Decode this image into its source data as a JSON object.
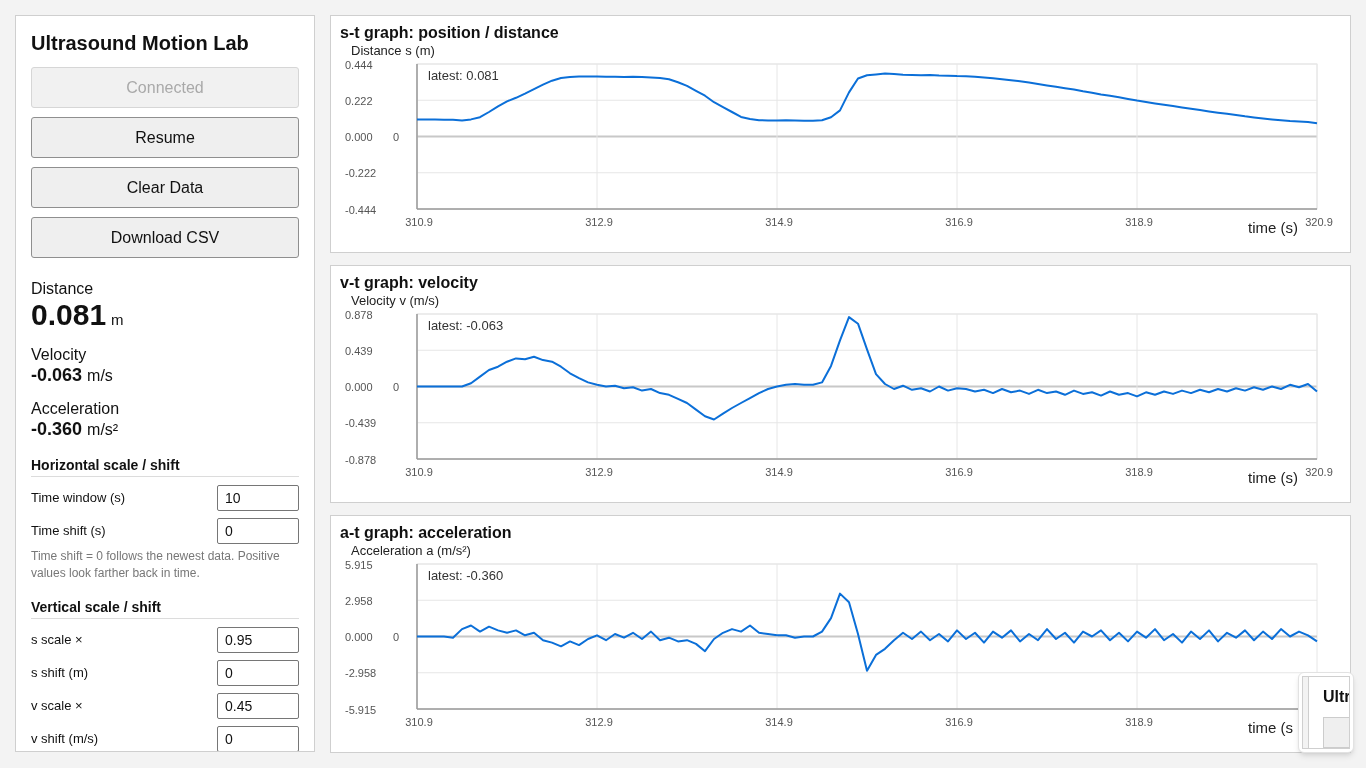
{
  "sidebar": {
    "title": "Ultrasound Motion Lab",
    "buttons": [
      {
        "label": "Connected",
        "disabled": true
      },
      {
        "label": "Resume",
        "disabled": false
      },
      {
        "label": "Clear Data",
        "disabled": false
      },
      {
        "label": "Download CSV",
        "disabled": false
      }
    ],
    "readouts": [
      {
        "kind": "large",
        "label": "Distance",
        "value": "0.081",
        "unit": "m"
      },
      {
        "kind": "small",
        "label": "Velocity",
        "value": "-0.063",
        "unit": "m/s"
      },
      {
        "kind": "small",
        "label": "Acceleration",
        "value": "-0.360",
        "unit": "m/s²"
      }
    ],
    "sections": [
      {
        "heading": "Horizontal scale / shift",
        "fields": [
          {
            "label": "Time window (s)",
            "value": "10"
          },
          {
            "label": "Time shift (s)",
            "value": "0"
          }
        ],
        "note": "Time shift = 0 follows the newest data. Positive values look farther back in time."
      },
      {
        "heading": "Vertical scale / shift",
        "fields": [
          {
            "label": "s scale ×",
            "value": "0.95"
          },
          {
            "label": "s shift (m)",
            "value": "0"
          },
          {
            "label": "v scale ×",
            "value": "0.45"
          },
          {
            "label": "v shift (m/s)",
            "value": "0"
          }
        ]
      }
    ]
  },
  "graphs": [
    {
      "title": "s-t graph: position / distance",
      "latest": "latest: 0.081",
      "zero_label": "0",
      "chart_data": {
        "type": "line",
        "grid": true,
        "xlabel": "time (s)",
        "ylabel": "Distance s (m)",
        "xlim": [
          310.9,
          320.9
        ],
        "ylim": [
          -0.444,
          0.444
        ],
        "xticks": [
          {
            "value": 310.9,
            "label": "310.9"
          },
          {
            "value": 312.9,
            "label": "312.9"
          },
          {
            "value": 314.9,
            "label": "314.9"
          },
          {
            "value": 316.9,
            "label": "316.9"
          },
          {
            "value": 318.9,
            "label": "318.9"
          },
          {
            "value": 320.9,
            "label": "320.9"
          }
        ],
        "yticks": [
          {
            "value": 0.444,
            "label": "0.444"
          },
          {
            "value": 0.222,
            "label": "0.222"
          },
          {
            "value": 0,
            "label": "0.000"
          },
          {
            "value": -0.222,
            "label": "-0.222"
          },
          {
            "value": -0.444,
            "label": "-0.444"
          }
        ],
        "x": [
          310.9,
          311,
          311.1,
          311.2,
          311.3,
          311.4,
          311.5,
          311.6,
          311.7,
          311.8,
          311.9,
          312,
          312.1,
          312.2,
          312.3,
          312.4,
          312.5,
          312.6,
          312.7,
          312.8,
          312.9,
          313,
          313.1,
          313.2,
          313.3,
          313.4,
          313.5,
          313.6,
          313.7,
          313.8,
          313.9,
          314,
          314.1,
          314.2,
          314.3,
          314.4,
          314.5,
          314.6,
          314.7,
          314.8,
          314.9,
          315,
          315.1,
          315.2,
          315.3,
          315.4,
          315.5,
          315.6,
          315.7,
          315.8,
          315.9,
          316,
          316.1,
          316.2,
          316.3,
          316.4,
          316.5,
          316.6,
          316.7,
          316.8,
          316.9,
          317,
          317.1,
          317.2,
          317.3,
          317.4,
          317.5,
          317.6,
          317.7,
          317.8,
          317.9,
          318,
          318.1,
          318.2,
          318.3,
          318.4,
          318.5,
          318.6,
          318.7,
          318.8,
          318.9,
          319,
          319.1,
          319.2,
          319.3,
          319.4,
          319.5,
          319.6,
          319.7,
          319.8,
          319.9,
          320,
          320.1,
          320.2,
          320.3,
          320.4,
          320.5,
          320.6,
          320.7,
          320.8,
          320.9
        ],
        "values": [
          0.104,
          0.104,
          0.104,
          0.103,
          0.102,
          0.098,
          0.105,
          0.118,
          0.15,
          0.185,
          0.215,
          0.237,
          0.262,
          0.29,
          0.318,
          0.342,
          0.358,
          0.364,
          0.367,
          0.367,
          0.368,
          0.366,
          0.366,
          0.365,
          0.366,
          0.364,
          0.362,
          0.358,
          0.35,
          0.332,
          0.31,
          0.28,
          0.25,
          0.21,
          0.18,
          0.15,
          0.12,
          0.108,
          0.1,
          0.098,
          0.098,
          0.099,
          0.098,
          0.097,
          0.097,
          0.1,
          0.118,
          0.16,
          0.27,
          0.355,
          0.375,
          0.38,
          0.385,
          0.382,
          0.378,
          0.376,
          0.375,
          0.376,
          0.373,
          0.372,
          0.37,
          0.369,
          0.366,
          0.362,
          0.357,
          0.351,
          0.345,
          0.338,
          0.33,
          0.322,
          0.313,
          0.305,
          0.296,
          0.287,
          0.277,
          0.268,
          0.258,
          0.249,
          0.24,
          0.23,
          0.22,
          0.212,
          0.203,
          0.195,
          0.187,
          0.178,
          0.17,
          0.162,
          0.154,
          0.146,
          0.139,
          0.132,
          0.124,
          0.117,
          0.11,
          0.104,
          0.099,
          0.095,
          0.092,
          0.088,
          0.081
        ]
      }
    },
    {
      "title": "v-t graph: velocity",
      "latest": "latest: -0.063",
      "zero_label": "0",
      "chart_data": {
        "type": "line",
        "grid": true,
        "xlabel": "time (s)",
        "ylabel": "Velocity v (m/s)",
        "xlim": [
          310.9,
          320.9
        ],
        "ylim": [
          -0.878,
          0.878
        ],
        "xticks": [
          {
            "value": 310.9,
            "label": "310.9"
          },
          {
            "value": 312.9,
            "label": "312.9"
          },
          {
            "value": 314.9,
            "label": "314.9"
          },
          {
            "value": 316.9,
            "label": "316.9"
          },
          {
            "value": 318.9,
            "label": "318.9"
          },
          {
            "value": 320.9,
            "label": "320.9"
          }
        ],
        "yticks": [
          {
            "value": 0.878,
            "label": "0.878"
          },
          {
            "value": 0.439,
            "label": "0.439"
          },
          {
            "value": 0,
            "label": "0.000"
          },
          {
            "value": -0.439,
            "label": "-0.439"
          },
          {
            "value": -0.878,
            "label": "-0.878"
          }
        ],
        "x": [
          310.9,
          311,
          311.1,
          311.2,
          311.3,
          311.4,
          311.5,
          311.6,
          311.7,
          311.8,
          311.9,
          312,
          312.1,
          312.2,
          312.3,
          312.4,
          312.5,
          312.6,
          312.7,
          312.8,
          312.9,
          313,
          313.1,
          313.2,
          313.3,
          313.4,
          313.5,
          313.6,
          313.7,
          313.8,
          313.9,
          314,
          314.1,
          314.2,
          314.3,
          314.4,
          314.5,
          314.6,
          314.7,
          314.8,
          314.9,
          315,
          315.1,
          315.2,
          315.3,
          315.4,
          315.5,
          315.6,
          315.7,
          315.8,
          315.9,
          316,
          316.1,
          316.2,
          316.3,
          316.4,
          316.5,
          316.6,
          316.7,
          316.8,
          316.9,
          317,
          317.1,
          317.2,
          317.3,
          317.4,
          317.5,
          317.6,
          317.7,
          317.8,
          317.9,
          318,
          318.1,
          318.2,
          318.3,
          318.4,
          318.5,
          318.6,
          318.7,
          318.8,
          318.9,
          319,
          319.1,
          319.2,
          319.3,
          319.4,
          319.5,
          319.6,
          319.7,
          319.8,
          319.9,
          320,
          320.1,
          320.2,
          320.3,
          320.4,
          320.5,
          320.6,
          320.7,
          320.8,
          320.9
        ],
        "values": [
          0,
          0,
          0,
          0,
          0,
          0,
          0.04,
          0.12,
          0.2,
          0.24,
          0.3,
          0.34,
          0.33,
          0.36,
          0.32,
          0.3,
          0.24,
          0.16,
          0.1,
          0.05,
          0.02,
          0,
          0.01,
          -0.02,
          -0.01,
          -0.05,
          -0.03,
          -0.08,
          -0.1,
          -0.15,
          -0.2,
          -0.28,
          -0.36,
          -0.4,
          -0.33,
          -0.26,
          -0.2,
          -0.14,
          -0.08,
          -0.03,
          0,
          0.02,
          0.03,
          0.02,
          0.02,
          0.05,
          0.25,
          0.56,
          0.84,
          0.76,
          0.45,
          0.15,
          0.03,
          -0.03,
          0.01,
          -0.04,
          -0.02,
          -0.06,
          0,
          -0.05,
          -0.02,
          -0.03,
          -0.06,
          -0.04,
          -0.08,
          -0.03,
          -0.07,
          -0.05,
          -0.09,
          -0.04,
          -0.08,
          -0.06,
          -0.1,
          -0.05,
          -0.09,
          -0.07,
          -0.11,
          -0.06,
          -0.1,
          -0.08,
          -0.12,
          -0.07,
          -0.1,
          -0.06,
          -0.09,
          -0.05,
          -0.08,
          -0.04,
          -0.07,
          -0.03,
          -0.06,
          -0.02,
          -0.05,
          -0.01,
          -0.04,
          0,
          -0.03,
          0.02,
          -0.01,
          0.03,
          -0.06
        ]
      }
    },
    {
      "title": "a-t graph: acceleration",
      "latest": "latest: -0.360",
      "zero_label": "0",
      "chart_data": {
        "type": "line",
        "grid": true,
        "xlabel": "time (s",
        "ylabel": "Acceleration a (m/s²)",
        "xlim": [
          310.9,
          320.9
        ],
        "ylim": [
          -5.915,
          5.915
        ],
        "xticks": [
          {
            "value": 310.9,
            "label": "310.9"
          },
          {
            "value": 312.9,
            "label": "312.9"
          },
          {
            "value": 314.9,
            "label": "314.9"
          },
          {
            "value": 316.9,
            "label": "316.9"
          },
          {
            "value": 318.9,
            "label": "318.9"
          }
        ],
        "yticks": [
          {
            "value": 5.915,
            "label": "5.915"
          },
          {
            "value": 2.958,
            "label": "2.958"
          },
          {
            "value": 0,
            "label": "0.000"
          },
          {
            "value": -2.958,
            "label": "-2.958"
          },
          {
            "value": -5.915,
            "label": "-5.915"
          }
        ],
        "x": [
          310.9,
          311,
          311.1,
          311.2,
          311.3,
          311.4,
          311.5,
          311.6,
          311.7,
          311.8,
          311.9,
          312,
          312.1,
          312.2,
          312.3,
          312.4,
          312.5,
          312.6,
          312.7,
          312.8,
          312.9,
          313,
          313.1,
          313.2,
          313.3,
          313.4,
          313.5,
          313.6,
          313.7,
          313.8,
          313.9,
          314,
          314.1,
          314.2,
          314.3,
          314.4,
          314.5,
          314.6,
          314.7,
          314.8,
          314.9,
          315,
          315.1,
          315.2,
          315.3,
          315.4,
          315.5,
          315.6,
          315.7,
          315.8,
          315.9,
          316,
          316.1,
          316.2,
          316.3,
          316.4,
          316.5,
          316.6,
          316.7,
          316.8,
          316.9,
          317,
          317.1,
          317.2,
          317.3,
          317.4,
          317.5,
          317.6,
          317.7,
          317.8,
          317.9,
          318,
          318.1,
          318.2,
          318.3,
          318.4,
          318.5,
          318.6,
          318.7,
          318.8,
          318.9,
          319,
          319.1,
          319.2,
          319.3,
          319.4,
          319.5,
          319.6,
          319.7,
          319.8,
          319.9,
          320,
          320.1,
          320.2,
          320.3,
          320.4,
          320.5,
          320.6,
          320.7,
          320.8,
          320.9
        ],
        "values": [
          0,
          0,
          0,
          0,
          -0.1,
          0.6,
          0.9,
          0.4,
          0.8,
          0.5,
          0.3,
          0.5,
          0.1,
          0.3,
          -0.3,
          -0.5,
          -0.8,
          -0.4,
          -0.7,
          -0.2,
          0.1,
          -0.3,
          0.2,
          -0.1,
          0.3,
          -0.2,
          0.4,
          -0.3,
          -0.1,
          -0.4,
          -0.3,
          -0.6,
          -1.2,
          -0.2,
          0.3,
          0.6,
          0.4,
          0.9,
          0.3,
          0.2,
          0.1,
          0.1,
          -0.1,
          0,
          0,
          0.4,
          1.5,
          3.5,
          2.8,
          0.2,
          -2.8,
          -1.5,
          -1.0,
          -0.3,
          0.3,
          -0.2,
          0.4,
          -0.3,
          0.2,
          -0.4,
          0.5,
          -0.2,
          0.3,
          -0.5,
          0.4,
          -0.1,
          0.5,
          -0.4,
          0.2,
          -0.3,
          0.6,
          -0.2,
          0.3,
          -0.5,
          0.4,
          0,
          0.5,
          -0.3,
          0.3,
          -0.4,
          0.4,
          -0.1,
          0.6,
          -0.3,
          0.2,
          -0.5,
          0.4,
          -0.2,
          0.5,
          -0.4,
          0.3,
          -0.1,
          0.5,
          -0.3,
          0.4,
          -0.2,
          0.6,
          0,
          0.4,
          0.1,
          -0.4
        ]
      }
    }
  ],
  "preview_thumbnail": {
    "title": "Ultr"
  }
}
